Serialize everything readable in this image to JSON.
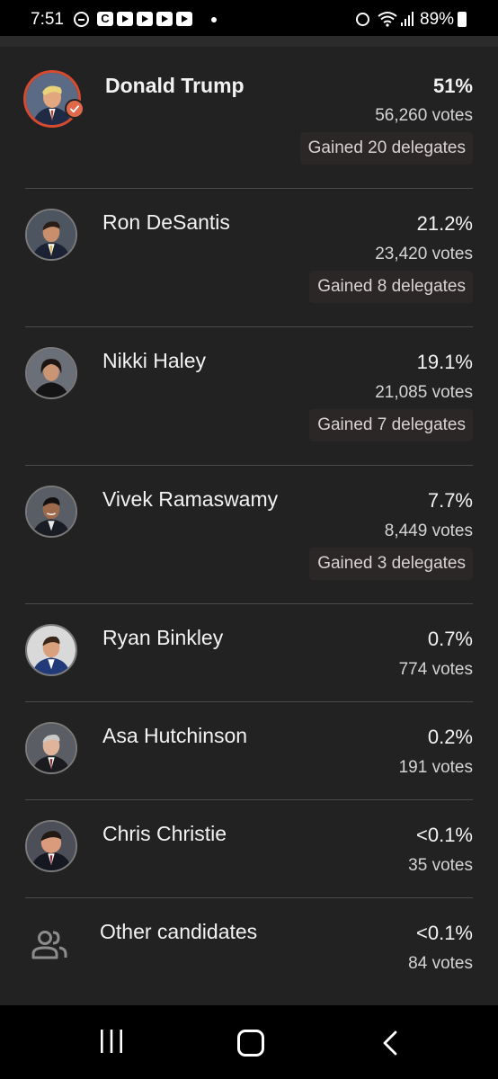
{
  "status_bar": {
    "time": "7:51",
    "app_c_label": "C",
    "battery": "89%"
  },
  "candidates": [
    {
      "name": "Donald Trump",
      "percent": "51%",
      "votes": "56,260 votes",
      "delegates": "Gained 20 delegates",
      "winner": true
    },
    {
      "name": "Ron DeSantis",
      "percent": "21.2%",
      "votes": "23,420 votes",
      "delegates": "Gained 8 delegates"
    },
    {
      "name": "Nikki Haley",
      "percent": "19.1%",
      "votes": "21,085 votes",
      "delegates": "Gained 7 delegates"
    },
    {
      "name": "Vivek Ramaswamy",
      "percent": "7.7%",
      "votes": "8,449 votes",
      "delegates": "Gained 3 delegates"
    },
    {
      "name": "Ryan Binkley",
      "percent": "0.7%",
      "votes": "774 votes"
    },
    {
      "name": "Asa Hutchinson",
      "percent": "0.2%",
      "votes": "191 votes"
    },
    {
      "name": "Chris Christie",
      "percent": "<0.1%",
      "votes": "35 votes"
    },
    {
      "name": "Other candidates",
      "percent": "<0.1%",
      "votes": "84 votes"
    }
  ],
  "colors": {
    "background": "#222222",
    "winner_ring": "#d64a2f",
    "winner_check": "#e1694b",
    "divider": "#4a4a4a"
  },
  "icons": {
    "winner_badge": "checkmark-icon",
    "other_candidates": "people-icon",
    "nav_recents": "recents-icon",
    "nav_home": "home-icon",
    "nav_back": "back-icon"
  }
}
